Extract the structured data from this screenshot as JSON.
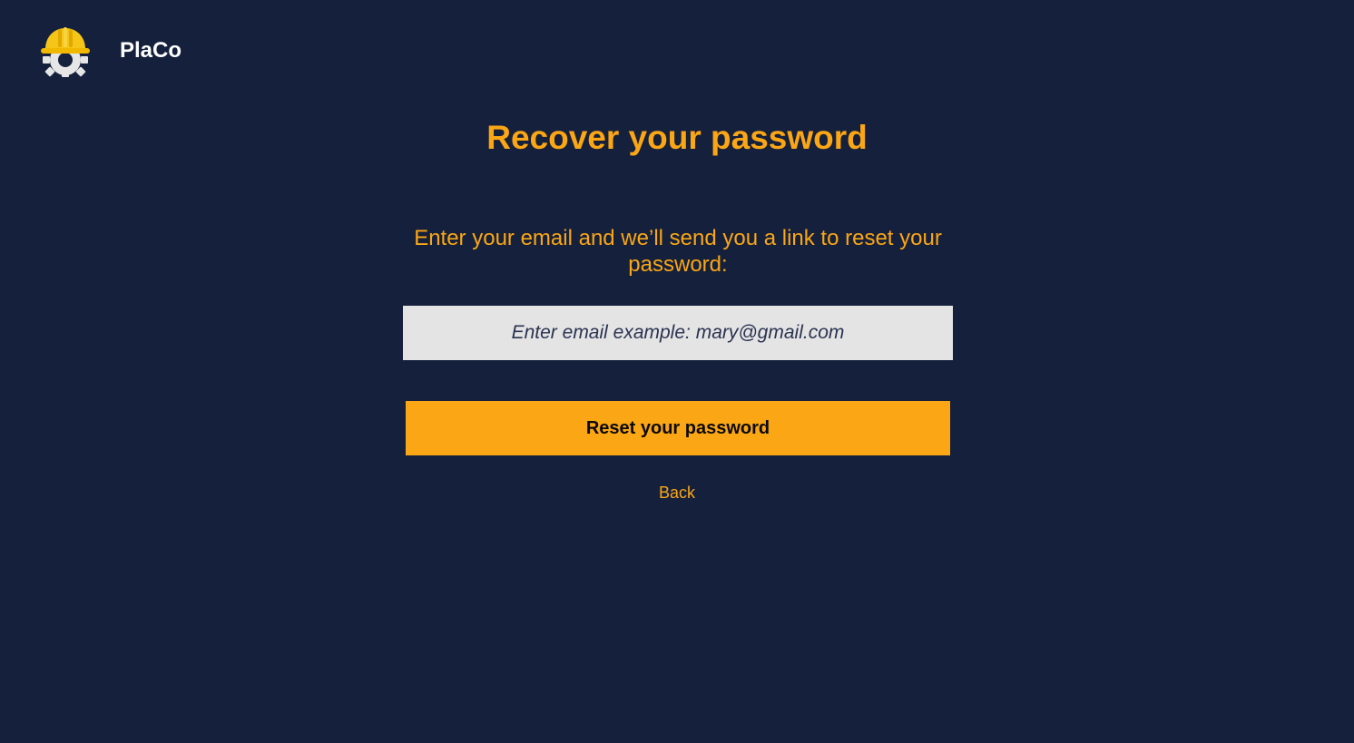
{
  "header": {
    "brand_name": "PlaCo",
    "logo_icon": "hardhat-gear-icon"
  },
  "recover": {
    "title": "Recover your password",
    "instructions": "Enter your email and we’ll send you a link to reset your password:",
    "email": {
      "value": "",
      "placeholder": "Enter email example: mary@gmail.com"
    },
    "reset_button_label": "Reset your password",
    "back_link_label": "Back"
  },
  "colors": {
    "background": "#14203c",
    "accent": "#fba614",
    "input_background": "#e4e4e5",
    "brand_text": "#ffffff",
    "hardhat": "#f5c518",
    "gear": "#e6e6e6"
  }
}
